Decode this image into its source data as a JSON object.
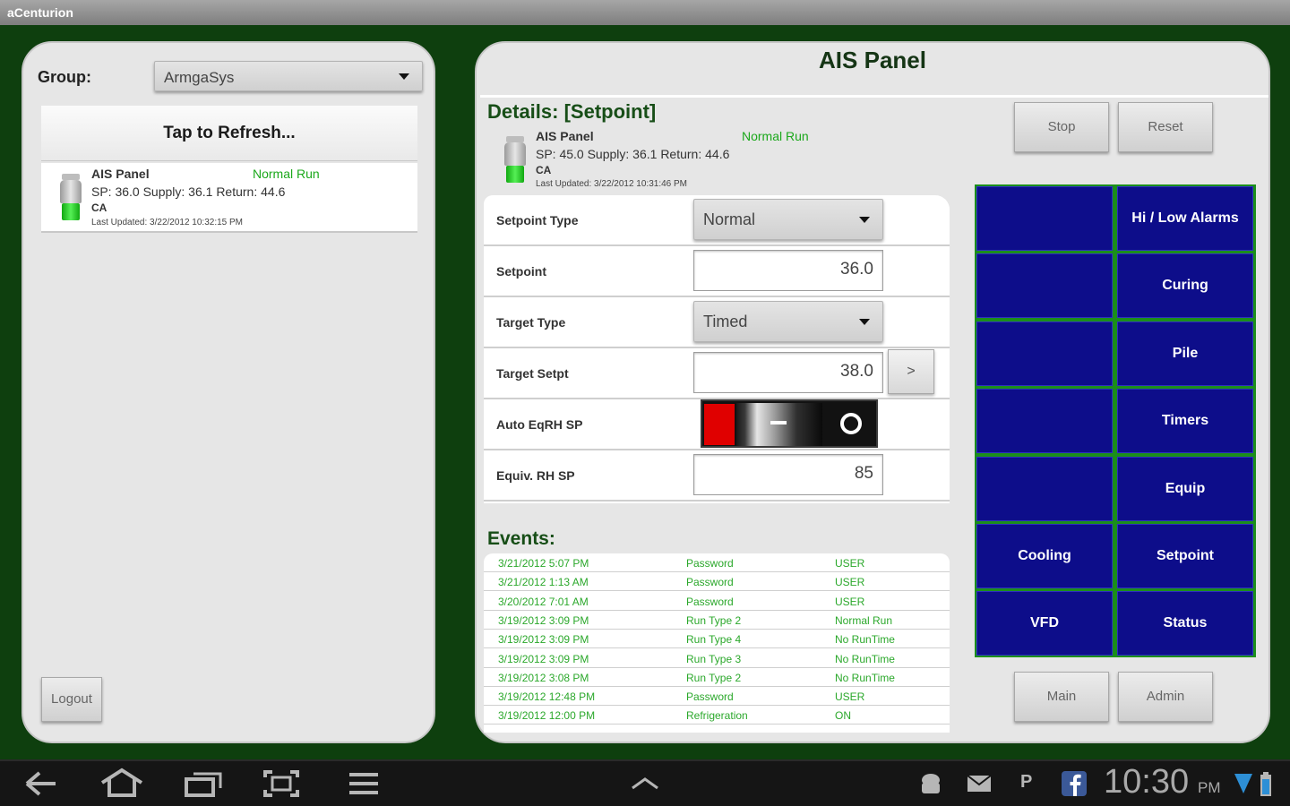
{
  "titlebar": {
    "title": "aCenturion"
  },
  "left_panel": {
    "group_label": "Group:",
    "group_value": "ArmgaSys",
    "refresh_label": "Tap to Refresh...",
    "device": {
      "name": "AIS Panel",
      "status": "Normal Run",
      "readings": "SP: 36.0   Supply: 36.1   Return: 44.6",
      "location": "CA",
      "updated": "Last Updated: 3/22/2012 10:32:15 PM"
    },
    "logout_label": "Logout"
  },
  "right_panel": {
    "title": "AIS Panel",
    "details_title": "Details: [Setpoint]",
    "device": {
      "name": "AIS Panel",
      "status": "Normal Run",
      "readings": "SP: 45.0   Supply: 36.1   Return: 44.6",
      "location": "CA",
      "updated": "Last Updated: 3/22/2012 10:31:46 PM"
    },
    "stop_label": "Stop",
    "reset_label": "Reset",
    "form": {
      "setpoint_type_label": "Setpoint Type",
      "setpoint_type_value": "Normal",
      "setpoint_label": "Setpoint",
      "setpoint_value": "36.0",
      "target_type_label": "Target Type",
      "target_type_value": "Timed",
      "target_setpt_label": "Target Setpt",
      "target_setpt_value": "38.0",
      "target_arrow": ">",
      "auto_eqrh_label": "Auto EqRH SP",
      "auto_eqrh_state": "off",
      "equiv_rh_label": "Equiv. RH SP",
      "equiv_rh_value": "85"
    },
    "events_title": "Events:",
    "events": [
      [
        "3/21/2012 5:07 PM",
        "Password",
        "USER"
      ],
      [
        "3/21/2012 1:13 AM",
        "Password",
        "USER"
      ],
      [
        "3/20/2012 7:01 AM",
        "Password",
        "USER"
      ],
      [
        "3/19/2012 3:09 PM",
        "Run Type 2",
        "Normal Run"
      ],
      [
        "3/19/2012 3:09 PM",
        "Run Type 4",
        "No RunTime"
      ],
      [
        "3/19/2012 3:09 PM",
        "Run Type 3",
        "No RunTime"
      ],
      [
        "3/19/2012 3:08 PM",
        "Run Type 2",
        "No RunTime"
      ],
      [
        "3/19/2012 12:48 PM",
        "Password",
        "USER"
      ],
      [
        "3/19/2012 12:00 PM",
        "Refrigeration",
        "ON"
      ]
    ],
    "nav_tiles": [
      [
        "",
        "Hi / Low Alarms"
      ],
      [
        "",
        "Curing"
      ],
      [
        "",
        "Pile"
      ],
      [
        "",
        "Timers"
      ],
      [
        "",
        "Equip"
      ],
      [
        "Cooling",
        "Setpoint"
      ],
      [
        "VFD",
        "Status"
      ]
    ],
    "main_label": "Main",
    "admin_label": "Admin"
  },
  "system_bar": {
    "time": "10:30",
    "ampm": "PM",
    "p_label": "P"
  }
}
